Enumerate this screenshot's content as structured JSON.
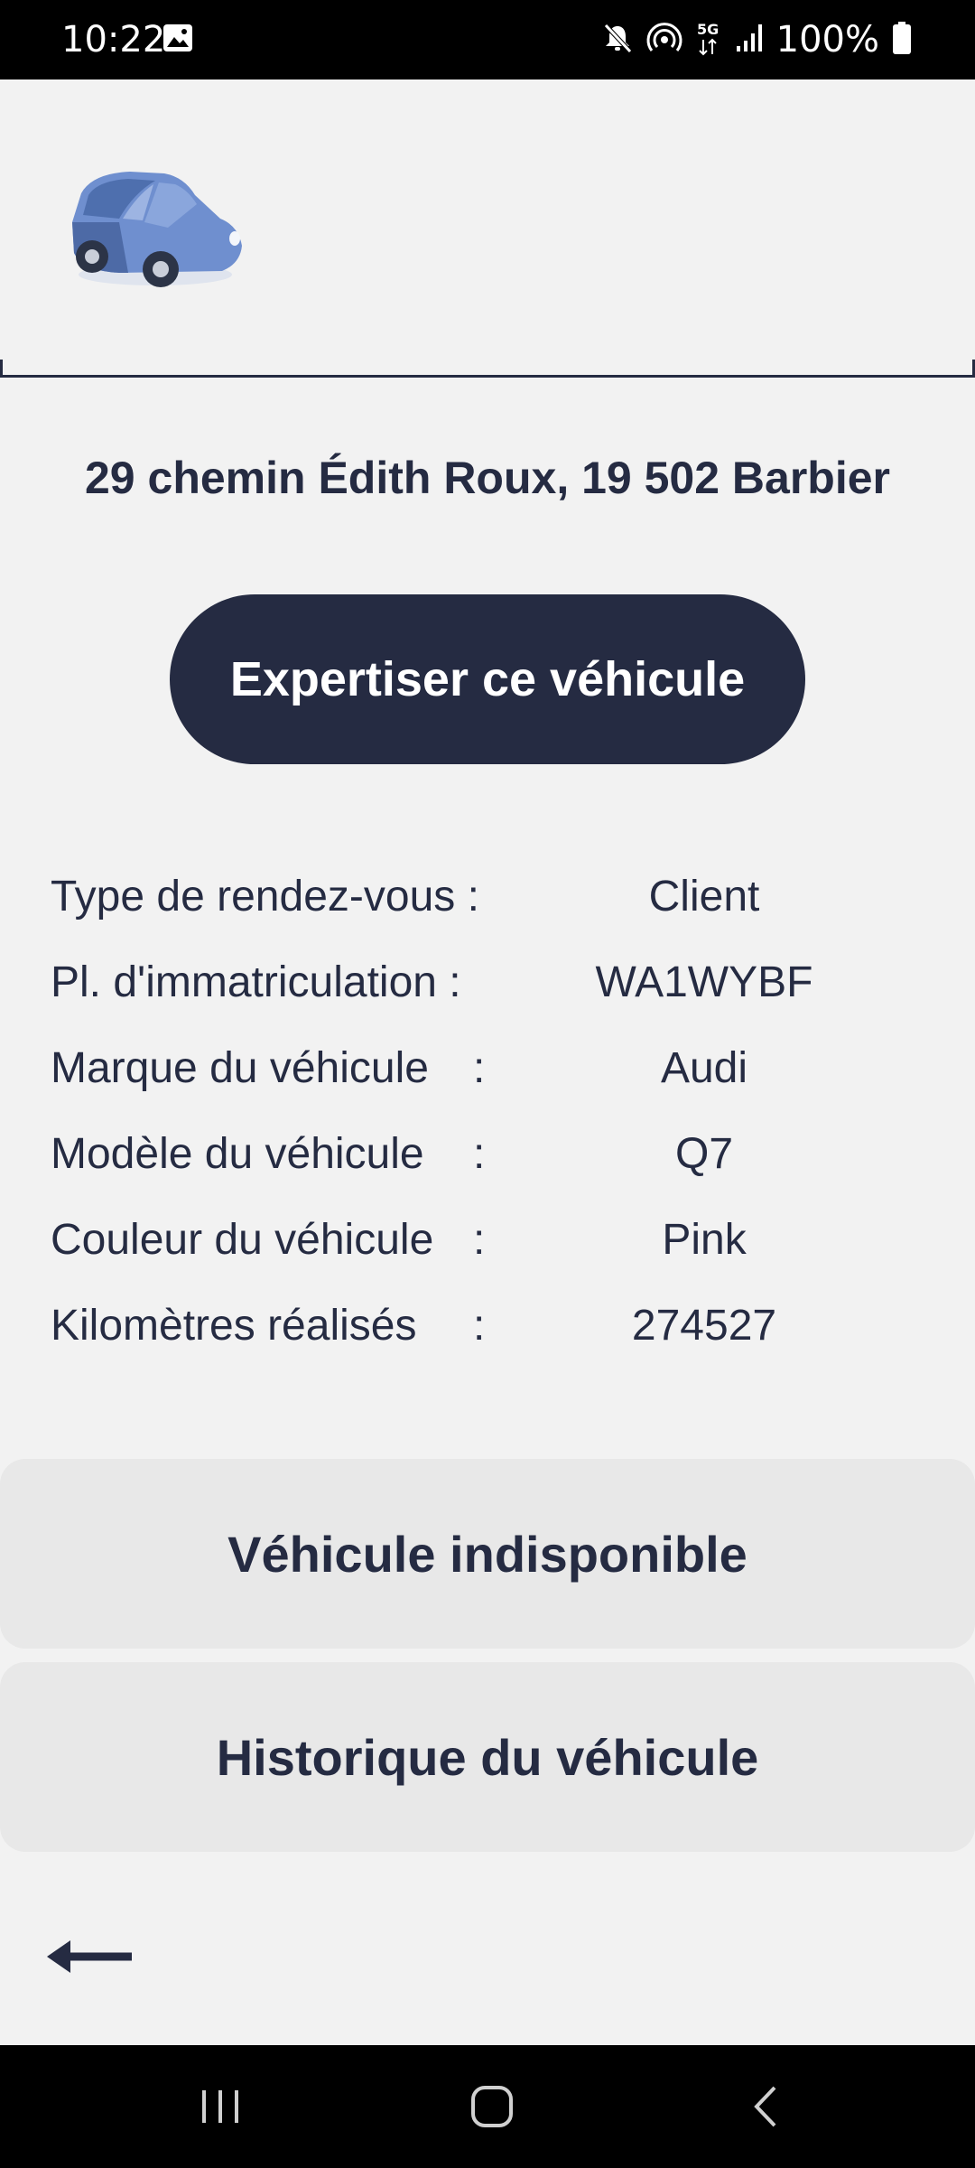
{
  "status_bar": {
    "time": "10:22",
    "battery_text": "100%",
    "network_label": "5G",
    "icons": [
      "image-icon",
      "mute-icon",
      "hotspot-icon",
      "5g-icon",
      "signal-icon",
      "battery-icon"
    ]
  },
  "header": {
    "logo_icon": "car-icon",
    "logo_color": "#5b7fbf"
  },
  "appointment": {
    "address": "29 chemin Édith Roux, 19 502 Barbier",
    "primary_button": "Expertiser ce véhicule"
  },
  "details": [
    {
      "label": "Type de rendez-vous :",
      "colon": "",
      "value": "Client"
    },
    {
      "label": "Pl. d'immatriculation :",
      "colon": "",
      "value": "WA1WYBF"
    },
    {
      "label": "Marque du véhicule",
      "colon": ":",
      "value": "Audi"
    },
    {
      "label": "Modèle du véhicule",
      "colon": ":",
      "value": "Q7"
    },
    {
      "label": "Couleur du véhicule",
      "colon": ":",
      "value": "Pink"
    },
    {
      "label": "Kilomètres réalisés",
      "colon": ":",
      "value": "274527"
    }
  ],
  "actions": {
    "unavailable": "Véhicule indisponible",
    "history": "Historique du véhicule"
  },
  "colors": {
    "primary": "#252b42",
    "background": "#f2f2f2",
    "secondary_button": "#e8e8e8"
  }
}
